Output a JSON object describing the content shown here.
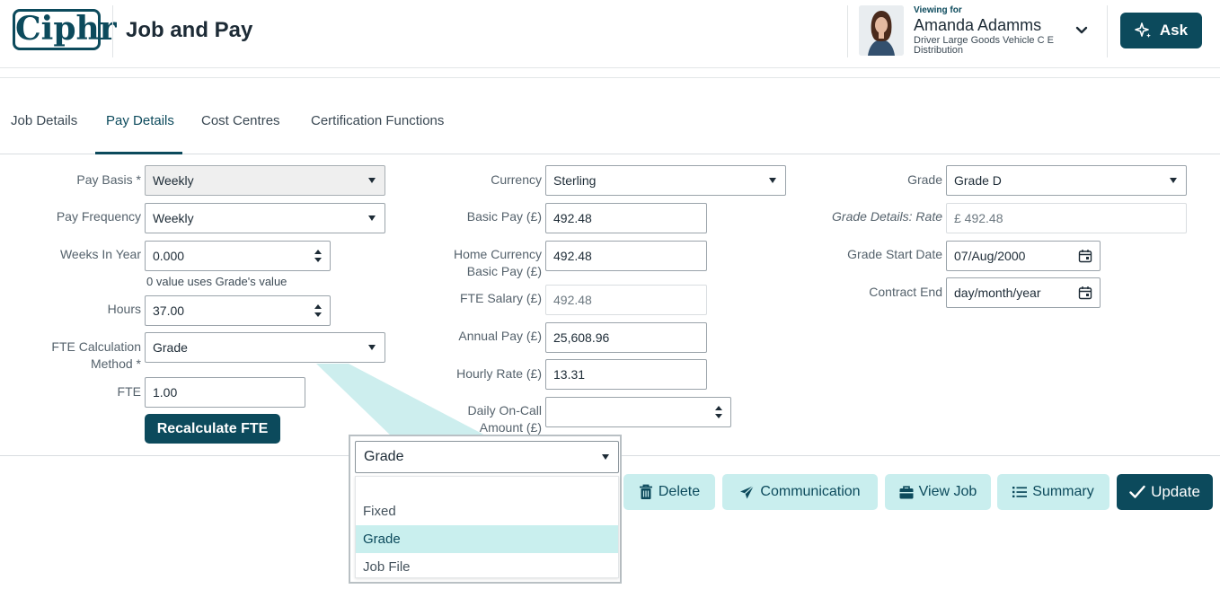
{
  "header": {
    "logo": "Ciphr",
    "title": "Job and Pay",
    "viewing_label": "Viewing for",
    "person_name": "Amanda Adamms",
    "person_role": "Driver Large Goods Vehicle C E Distribution",
    "ask_label": "Ask"
  },
  "tabs": [
    "Job Details",
    "Pay Details",
    "Cost Centres",
    "Certification Functions"
  ],
  "active_tab": "Pay Details",
  "form": {
    "pay_basis": {
      "label": "Pay Basis *",
      "value": "Weekly"
    },
    "pay_frequency": {
      "label": "Pay Frequency",
      "value": "Weekly"
    },
    "weeks_in_year": {
      "label": "Weeks In Year",
      "value": "0.000",
      "hint": "0 value uses Grade's value"
    },
    "hours": {
      "label": "Hours",
      "value": "37.00"
    },
    "fte_method": {
      "label1": "FTE Calculation",
      "label2": "Method *",
      "value": "Grade"
    },
    "fte": {
      "label": "FTE",
      "value": "1.00"
    },
    "recalc_label": "Recalculate FTE",
    "currency": {
      "label": "Currency",
      "value": "Sterling"
    },
    "basic_pay": {
      "label": "Basic Pay (£)",
      "value": "492.48"
    },
    "home_basic_pay": {
      "label1": "Home Currency",
      "label2": "Basic Pay (£)",
      "value": "492.48"
    },
    "fte_salary": {
      "label": "FTE Salary (£)",
      "value": "492.48"
    },
    "annual_pay": {
      "label": "Annual Pay (£)",
      "value": "25,608.96"
    },
    "hourly_rate": {
      "label": "Hourly Rate (£)",
      "value": "13.31"
    },
    "daily_oncall": {
      "label1": "Daily On-Call",
      "label2": "Amount (£)",
      "value": ""
    },
    "grade": {
      "label": "Grade",
      "value": "Grade D"
    },
    "grade_rate": {
      "label": "Grade Details: Rate",
      "value": "£ 492.48"
    },
    "grade_start": {
      "label": "Grade Start Date",
      "value": "07/Aug/2000"
    },
    "contract_end": {
      "label": "Contract End",
      "value": "day/month/year"
    }
  },
  "actions": {
    "delete": "Delete",
    "communication": "Communication",
    "view_job": "View Job",
    "summary": "Summary",
    "update": "Update"
  },
  "dropdown": {
    "selected": "Grade",
    "options": [
      "Fixed",
      "Grade",
      "Job File"
    ]
  },
  "colors": {
    "brand": "#0c4a5c",
    "accent_light": "#c9eeee"
  }
}
